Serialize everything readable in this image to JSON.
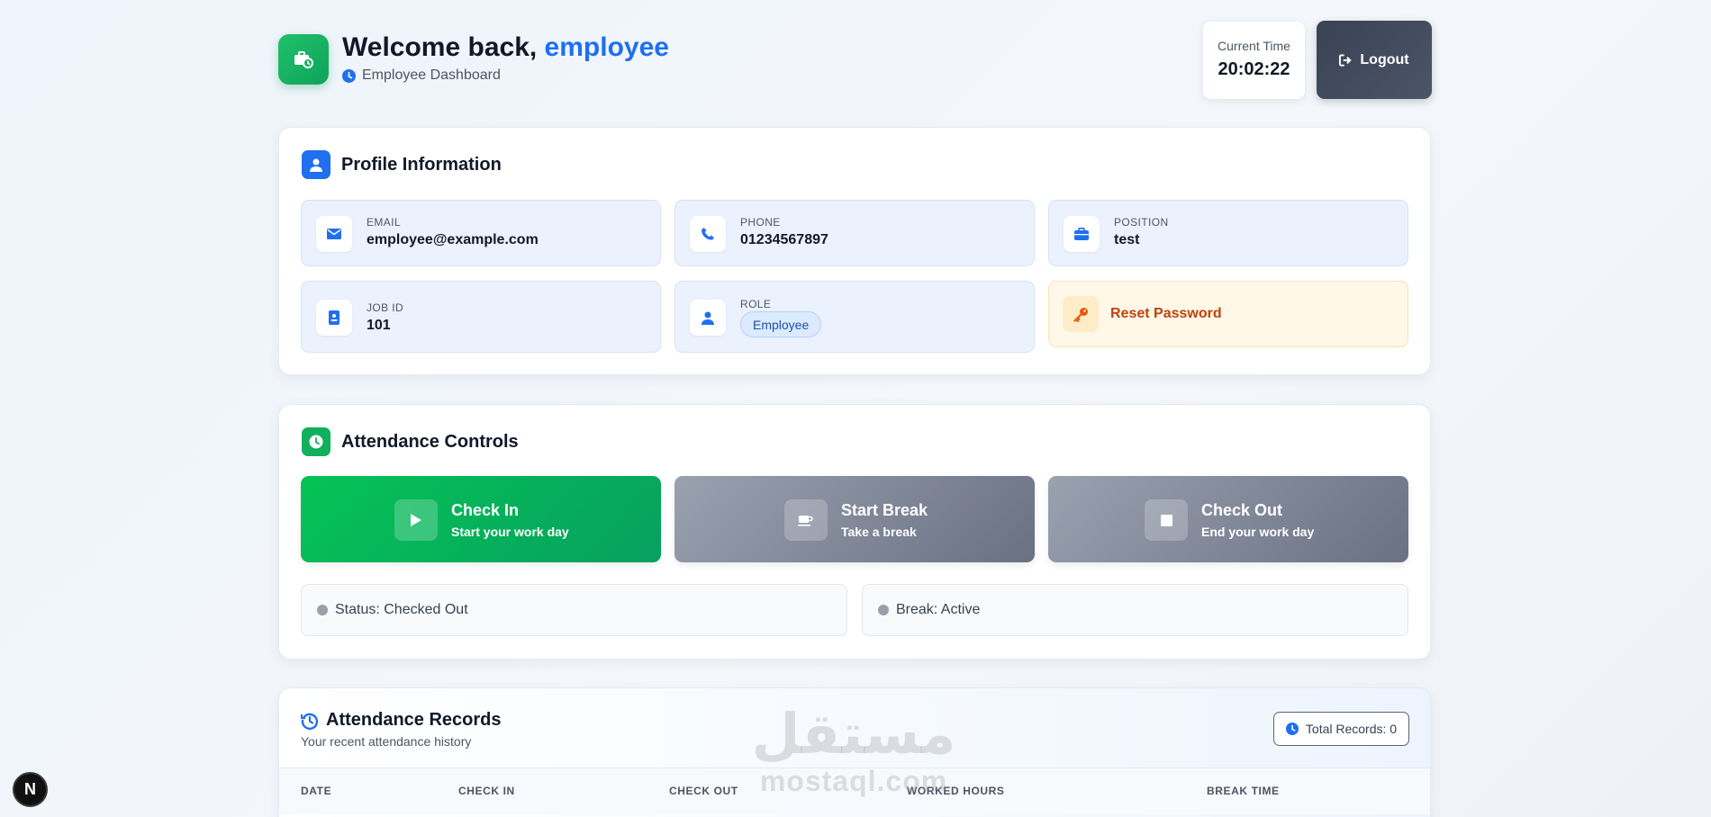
{
  "header": {
    "welcome_prefix": "Welcome back, ",
    "username": "employee",
    "subtitle": "Employee Dashboard",
    "time_label": "Current Time",
    "time_value": "20:02:22",
    "logout_label": "Logout"
  },
  "profile": {
    "title": "Profile Information",
    "email_label": "EMAIL",
    "email_value": "employee@example.com",
    "phone_label": "PHONE",
    "phone_value": "01234567897",
    "position_label": "POSITION",
    "position_value": "test",
    "jobid_label": "JOB ID",
    "jobid_value": "101",
    "role_label": "ROLE",
    "role_value": "Employee",
    "reset_label": "Reset Password"
  },
  "attendance": {
    "title": "Attendance Controls",
    "checkin_title": "Check In",
    "checkin_sub": "Start your work day",
    "break_title": "Start Break",
    "break_sub": "Take a break",
    "checkout_title": "Check Out",
    "checkout_sub": "End your work day",
    "status_text": "Status: Checked Out",
    "break_text": "Break: Active"
  },
  "records": {
    "title": "Attendance Records",
    "subtitle": "Your recent attendance history",
    "total_label": "Total Records: 0",
    "columns": [
      "DATE",
      "CHECK IN",
      "CHECK OUT",
      "WORKED HOURS",
      "BREAK TIME"
    ]
  },
  "watermark": {
    "arabic": "مستقل",
    "latin": "mostaql.com"
  },
  "dev_badge": "N",
  "colors": {
    "brand_blue": "#1f6ff0",
    "brand_green": "#10b05c",
    "warning_text": "#c2410c",
    "neutral_button": "#6a7183"
  },
  "icons": {
    "logo": "briefcase-clock-icon",
    "subtitle": "clock-icon",
    "logout": "sign-out-icon",
    "profile": "user-icon",
    "email": "envelope-icon",
    "phone": "phone-icon",
    "position": "briefcase-icon",
    "jobid": "id-badge-icon",
    "role": "user-icon",
    "reset": "key-icon",
    "attendance": "clock-icon",
    "checkin": "play-icon",
    "break": "coffee-icon",
    "checkout": "stop-icon",
    "records": "history-icon"
  }
}
